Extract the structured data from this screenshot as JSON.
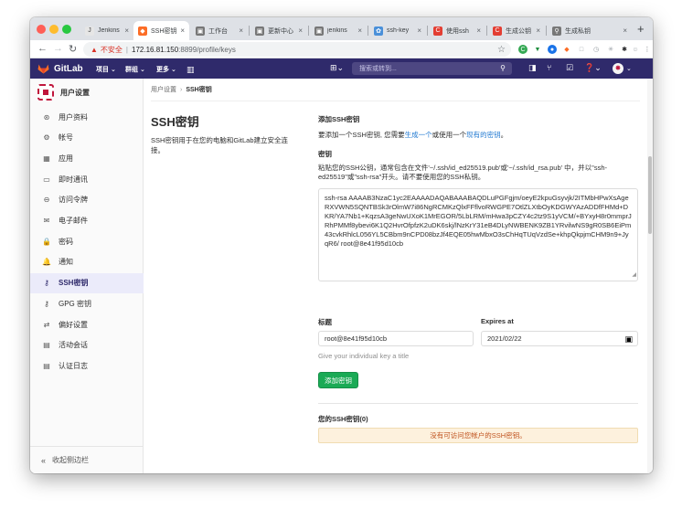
{
  "tabs": [
    {
      "title": "Jenkins",
      "icon": "jenkins-icon",
      "color": "#e6e6e6",
      "active": false
    },
    {
      "title": "SSH密钥",
      "icon": "gitlab-tab-icon",
      "color": "#fc6d26",
      "active": true
    },
    {
      "title": "工作台",
      "icon": "work-icon",
      "color": "#777777",
      "active": false
    },
    {
      "title": "更新中心",
      "icon": "update-icon",
      "color": "#777777",
      "active": false
    },
    {
      "title": "jenkins",
      "icon": "jenkins-search-icon",
      "color": "#777777",
      "active": false
    },
    {
      "title": "ssh-key",
      "icon": "sync-icon",
      "color": "#4a90d9",
      "active": false
    },
    {
      "title": "使用ssh",
      "icon": "csdn-icon",
      "color": "#e33e33",
      "active": false
    },
    {
      "title": "生成公钥",
      "icon": "csdn-icon",
      "color": "#e33e33",
      "active": false
    },
    {
      "title": "生成私钥",
      "icon": "search-icon",
      "color": "#777777",
      "active": false
    }
  ],
  "address": {
    "insecure_label": "不安全",
    "host": "172.16.81.150",
    "path": ":8899/profile/keys"
  },
  "gitlab": {
    "name": "GitLab",
    "menus": [
      "项目",
      "群组",
      "更多"
    ],
    "search_placeholder": "搜索或转到..."
  },
  "sidebar": {
    "title": "用户设置",
    "items": [
      {
        "label": "用户资料",
        "icon": "profile-icon",
        "glyph": "⊛"
      },
      {
        "label": "帐号",
        "icon": "account-icon",
        "glyph": "⚙"
      },
      {
        "label": "应用",
        "icon": "apps-icon",
        "glyph": "▦"
      },
      {
        "label": "即时通讯",
        "icon": "chat-icon",
        "glyph": "▭"
      },
      {
        "label": "访问令牌",
        "icon": "token-icon",
        "glyph": "⊖"
      },
      {
        "label": "电子邮件",
        "icon": "email-icon",
        "glyph": "✉"
      },
      {
        "label": "密码",
        "icon": "lock-icon",
        "glyph": "🔒"
      },
      {
        "label": "通知",
        "icon": "bell-icon",
        "glyph": "🔔"
      },
      {
        "label": "SSH密钥",
        "icon": "key-icon",
        "glyph": "⚷",
        "active": true
      },
      {
        "label": "GPG 密钥",
        "icon": "gpg-key-icon",
        "glyph": "⚷"
      },
      {
        "label": "偏好设置",
        "icon": "preferences-icon",
        "glyph": "⇄"
      },
      {
        "label": "活动会话",
        "icon": "sessions-icon",
        "glyph": "▤"
      },
      {
        "label": "认证日志",
        "icon": "log-icon",
        "glyph": "▤"
      }
    ],
    "collapse_label": "收起侧边栏"
  },
  "breadcrumb": {
    "parent": "用户设置",
    "current": "SSH密钥"
  },
  "page": {
    "title": "SSH密钥",
    "description": "SSH密钥用于在您的电脑和GitLab建立安全连接。"
  },
  "form": {
    "add_heading": "添加SSH密钥",
    "intro_prefix": "要添加一个SSH密钥, 您需要",
    "intro_link1": "生成一个",
    "intro_middle": "或使用一个",
    "intro_link2": "现有的密钥",
    "intro_suffix": "。",
    "key_label": "密钥",
    "key_help": "粘贴您的SSH公钥，通常包含在文件'~/.ssh/id_ed25519.pub'或'~/.ssh/id_rsa.pub' 中，并以\"ssh-ed25519\"或\"ssh-rsa\"开头。请不要使用您的SSH私钥。",
    "key_value": "ssh-rsa AAAAB3NzaC1yc2EAAAADAQABAAABAQDLuPGFgjm/oeyE2kpuGsyvjk/2ITMbHPwXsAgeRXVWN5SQNTBSk3rOlmW7i86NgRCMKzQlxFFflvoRWGPE7OtlZLXtbOyKDGWYAzADDfFHMd+DKR/YA7Nb1+KqzsA3geNwUXoK1MrEGOR/5LbLRM/mHwa3pCZY4c2tz9S1yVCM/+BYxyH8r0mmprJRhPMMf8ybevi6K1Q2HvrOfpfzK2uDK6skj/lNzKrY31eB4DLyNWBENK9ZB1YRvilwNS9gR0SB6EiPm43cvkRhlcL056YL5CBbm9nCPD08bzJf4EQE05hwMbxO3sChHqTUqVzdSe+khpQkpjmCHM9n9+JyqR6/ root@8e41f95d10cb",
    "title_label": "标题",
    "title_value": "root@8e41f95d10cb",
    "expires_label": "Expires at",
    "expires_value": "2021/02/22",
    "title_hint": "Give your individual key a title",
    "submit_label": "添加密钥",
    "keys_heading": "您的SSH密钥(0)",
    "empty_message": "没有可访问您帐户的SSH密钥。"
  }
}
